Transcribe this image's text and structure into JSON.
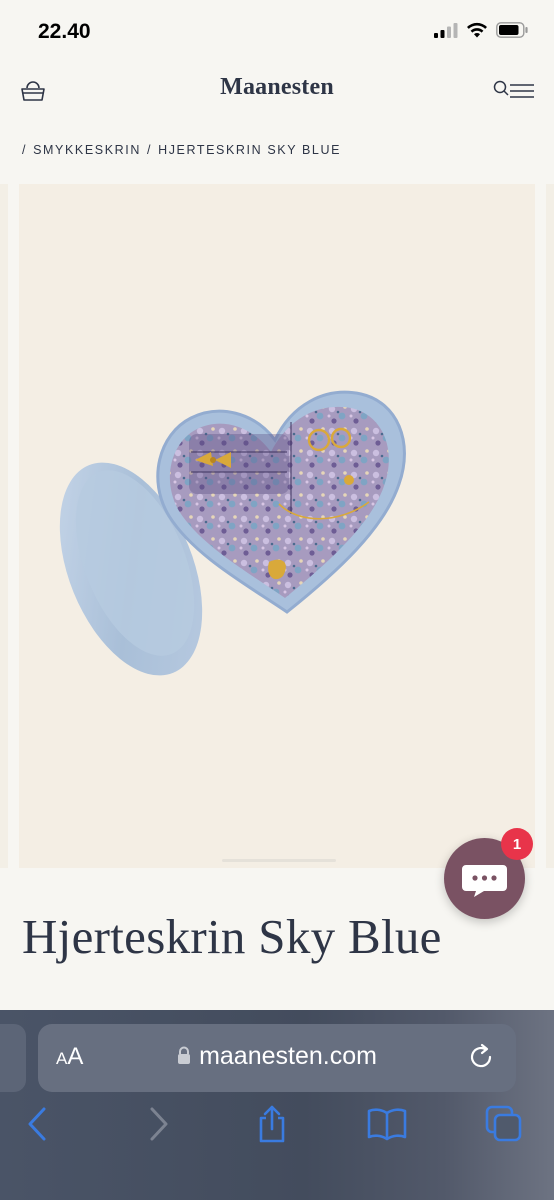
{
  "status_bar": {
    "time": "22.40",
    "icons": [
      "signal-icon",
      "wifi-icon",
      "battery-icon"
    ]
  },
  "header": {
    "logo": "Maanesten",
    "left_icon": "cart-icon",
    "right_icon": "search-menu-icon"
  },
  "breadcrumb": {
    "separator": "/",
    "items": [
      "SMYKKESKRIN",
      "HJERTESKRIN SKY BLUE"
    ]
  },
  "product": {
    "title": "Hjerteskrin Sky Blue",
    "image": "heart-jewelry-box-sky-blue"
  },
  "chat": {
    "badge_count": "1",
    "icon": "chat-icon"
  },
  "browser": {
    "text_size_small": "A",
    "text_size_large": "A",
    "url": "maanesten.com",
    "toolbar": [
      "back-icon",
      "forward-icon",
      "share-icon",
      "bookmarks-icon",
      "tabs-icon"
    ]
  },
  "colors": {
    "brand_text": "#2e3546",
    "page_background": "#f7f6f2",
    "image_background": "#f4eee4",
    "chat_button": "#7a5263",
    "badge": "#e8344a",
    "browser_accent": "#3a7be0"
  }
}
